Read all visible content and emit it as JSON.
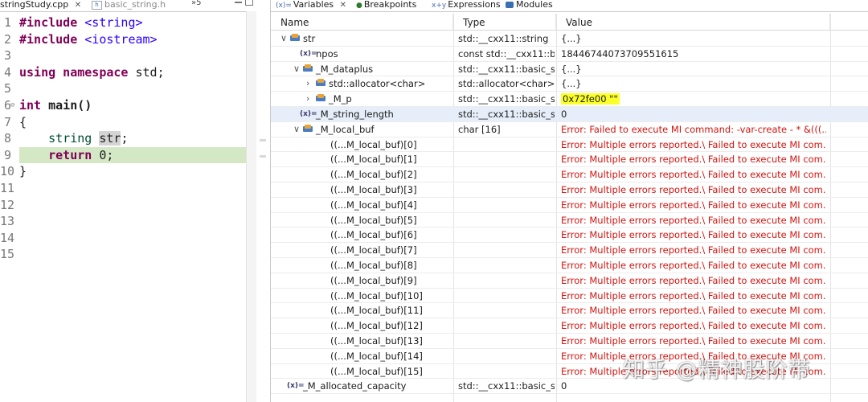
{
  "editor": {
    "tabs": [
      {
        "label": "stringStudy.cpp",
        "active": true
      },
      {
        "label": "basic_string.h",
        "active": false
      }
    ],
    "more_tabs": "»5",
    "lines": [
      {
        "n": "1",
        "parts": [
          {
            "t": "#include ",
            "c": "kw"
          },
          {
            "t": "<string>",
            "c": "str"
          }
        ]
      },
      {
        "n": "2",
        "parts": [
          {
            "t": "#include ",
            "c": "kw"
          },
          {
            "t": "<iostream>",
            "c": "str"
          }
        ]
      },
      {
        "n": "3",
        "parts": []
      },
      {
        "n": "4",
        "parts": [
          {
            "t": "using namespace ",
            "c": "kw"
          },
          {
            "t": "std;",
            "c": ""
          }
        ]
      },
      {
        "n": "5",
        "parts": []
      },
      {
        "n": "6",
        "parts": [
          {
            "t": "int ",
            "c": "kw"
          },
          {
            "t": "main()",
            "c": "b"
          }
        ],
        "fold": true
      },
      {
        "n": "7",
        "parts": [
          {
            "t": "{",
            "c": ""
          }
        ]
      },
      {
        "n": "8",
        "parts": [
          {
            "t": "    string ",
            "c": "kwn"
          },
          {
            "t": "str",
            "c": "hl"
          },
          {
            "t": ";",
            "c": ""
          }
        ]
      },
      {
        "n": "9",
        "parts": [
          {
            "t": "    return ",
            "c": "kw"
          },
          {
            "t": "0;",
            "c": ""
          }
        ],
        "current": true
      },
      {
        "n": "10",
        "parts": [
          {
            "t": "}",
            "c": ""
          }
        ]
      },
      {
        "n": "11",
        "parts": []
      },
      {
        "n": "12",
        "parts": []
      },
      {
        "n": "13",
        "parts": []
      },
      {
        "n": "14",
        "parts": []
      },
      {
        "n": "15",
        "parts": []
      }
    ]
  },
  "debug_tabs": [
    {
      "label": "Variables",
      "active": true,
      "icon": "variables-icon"
    },
    {
      "label": "Breakpoints",
      "active": false,
      "icon": "breakpoints-icon"
    },
    {
      "label": "Expressions",
      "active": false,
      "icon": "expressions-icon"
    },
    {
      "label": "Modules",
      "active": false,
      "icon": "modules-icon"
    }
  ],
  "columns": {
    "name": "Name",
    "type": "Type",
    "value": "Value"
  },
  "variables": [
    {
      "name": "str",
      "type": "std::__cxx11::string",
      "value": "{...}",
      "depth": 0,
      "twisty": "open",
      "icon": "struct-icon"
    },
    {
      "name": "npos",
      "type": "const std::__cxx11::b...",
      "value": "18446744073709551615",
      "depth": 1,
      "twisty": "",
      "icon": "field-icon"
    },
    {
      "name": "_M_dataplus",
      "type": "std::__cxx11::basic_st...",
      "value": "{...}",
      "depth": 1,
      "twisty": "open",
      "icon": "struct-icon"
    },
    {
      "name": "std::allocator<char>",
      "type": "std::allocator<char>",
      "value": "{...}",
      "depth": 2,
      "twisty": "closed",
      "icon": "struct-icon"
    },
    {
      "name": "_M_p",
      "type": "std::__cxx11::basic_st...",
      "value": "0x72fe00 \"\"",
      "depth": 2,
      "twisty": "closed",
      "icon": "struct-icon",
      "highlight": true
    },
    {
      "name": "_M_string_length",
      "type": "std::__cxx11::basic_st...",
      "value": "0",
      "depth": 1,
      "twisty": "",
      "icon": "field-icon",
      "selected": true
    },
    {
      "name": "_M_local_buf",
      "type": "char [16]",
      "value": "Error: Failed to execute MI command: -var-create - * &(((...",
      "depth": 1,
      "twisty": "open",
      "icon": "struct-icon",
      "error": true
    },
    {
      "name": "((...M_local_buf)[0]",
      "type": "",
      "value": "Error: Multiple errors reported.\\ Failed to execute MI com...",
      "depth": 3,
      "error": true
    },
    {
      "name": "((...M_local_buf)[1]",
      "type": "",
      "value": "Error: Multiple errors reported.\\ Failed to execute MI com...",
      "depth": 3,
      "error": true
    },
    {
      "name": "((...M_local_buf)[2]",
      "type": "",
      "value": "Error: Multiple errors reported.\\ Failed to execute MI com...",
      "depth": 3,
      "error": true
    },
    {
      "name": "((...M_local_buf)[3]",
      "type": "",
      "value": "Error: Multiple errors reported.\\ Failed to execute MI com...",
      "depth": 3,
      "error": true
    },
    {
      "name": "((...M_local_buf)[4]",
      "type": "",
      "value": "Error: Multiple errors reported.\\ Failed to execute MI com...",
      "depth": 3,
      "error": true
    },
    {
      "name": "((...M_local_buf)[5]",
      "type": "",
      "value": "Error: Multiple errors reported.\\ Failed to execute MI com...",
      "depth": 3,
      "error": true
    },
    {
      "name": "((...M_local_buf)[6]",
      "type": "",
      "value": "Error: Multiple errors reported.\\ Failed to execute MI com...",
      "depth": 3,
      "error": true
    },
    {
      "name": "((...M_local_buf)[7]",
      "type": "",
      "value": "Error: Multiple errors reported.\\ Failed to execute MI com...",
      "depth": 3,
      "error": true
    },
    {
      "name": "((...M_local_buf)[8]",
      "type": "",
      "value": "Error: Multiple errors reported.\\ Failed to execute MI com...",
      "depth": 3,
      "error": true
    },
    {
      "name": "((...M_local_buf)[9]",
      "type": "",
      "value": "Error: Multiple errors reported.\\ Failed to execute MI com...",
      "depth": 3,
      "error": true
    },
    {
      "name": "((...M_local_buf)[10]",
      "type": "",
      "value": "Error: Multiple errors reported.\\ Failed to execute MI com...",
      "depth": 3,
      "error": true
    },
    {
      "name": "((...M_local_buf)[11]",
      "type": "",
      "value": "Error: Multiple errors reported.\\ Failed to execute MI com...",
      "depth": 3,
      "error": true
    },
    {
      "name": "((...M_local_buf)[12]",
      "type": "",
      "value": "Error: Multiple errors reported.\\ Failed to execute MI com...",
      "depth": 3,
      "error": true
    },
    {
      "name": "((...M_local_buf)[13]",
      "type": "",
      "value": "Error: Multiple errors reported.\\ Failed to execute MI com...",
      "depth": 3,
      "error": true
    },
    {
      "name": "((...M_local_buf)[14]",
      "type": "",
      "value": "Error: Multiple errors reported.\\ Failed to execute MI com...",
      "depth": 3,
      "error": true
    },
    {
      "name": "((...M_local_buf)[15]",
      "type": "",
      "value": "Error: Multiple errors reported.\\ Failed to execute MI com...",
      "depth": 3,
      "error": true
    },
    {
      "name": "_M_allocated_capacity",
      "type": "std::__cxx11::basic_st...",
      "value": "0",
      "depth": 0,
      "twisty": "",
      "icon": "field-icon"
    }
  ],
  "watermark": "知乎 @精神股阶带"
}
